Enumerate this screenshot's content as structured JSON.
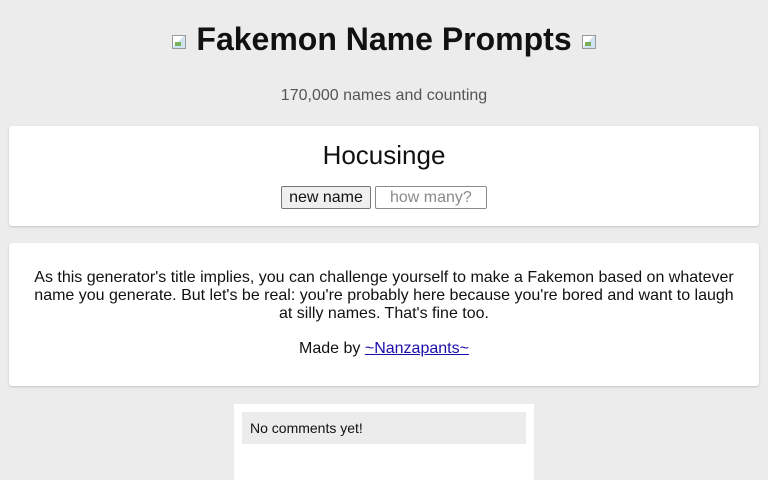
{
  "header": {
    "title": "Fakemon Name Prompts",
    "subtitle": "170,000 names and counting",
    "left_image_icon": "broken-image-icon",
    "right_image_icon": "broken-image-icon"
  },
  "generator": {
    "name": "Hocusinge",
    "new_name_label": "new name",
    "count_placeholder": "how many?",
    "count_value": ""
  },
  "info": {
    "description": "As this generator's title implies, you can challenge yourself to make a Fakemon based on whatever name you generate. But let's be real: you're probably here because you're bored and want to laugh at silly names. That's fine too.",
    "credit_prefix": "Made by ",
    "credit_link": "~Nanzapants~",
    "link_color": "#1a0dab"
  },
  "comments": {
    "empty_text": "No comments yet!"
  },
  "colors": {
    "background": "#ececec",
    "card": "#ffffff"
  }
}
